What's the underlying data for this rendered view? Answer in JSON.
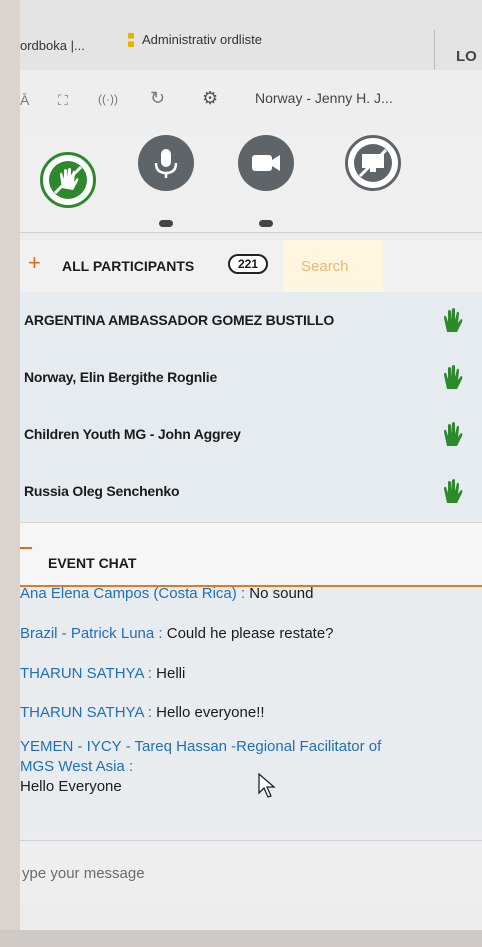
{
  "browser": {
    "tab_left": "ordboka |...",
    "tab_center": "Administrativ ordliste",
    "tab_right": "LO"
  },
  "toolbar": {
    "text_icon": "Ā",
    "fullscreen_icon": "⛶",
    "broadcast_icon": "((·))",
    "refresh_icon": "↻",
    "settings_icon": "⚙",
    "title": "Norway - Jenny H. J..."
  },
  "participants": {
    "header": "ALL PARTICIPANTS",
    "count": "221",
    "search_placeholder": "Search",
    "items": [
      {
        "name": "ARGENTINA AMBASSADOR GOMEZ BUSTILLO"
      },
      {
        "name": "Norway, Elin Bergithe Rognlie"
      },
      {
        "name": "Children Youth MG - John Aggrey"
      },
      {
        "name": "Russia Oleg Senchenko"
      }
    ],
    "hand_color": "#2c8a2c"
  },
  "chat": {
    "header": "EVENT CHAT",
    "messages": [
      {
        "sender": "Ana Elena Campos (Costa Rica) :",
        "text": "No sound"
      },
      {
        "sender": "Brazil - Patrick Luna :",
        "text": "Could he please restate?"
      },
      {
        "sender": "THARUN SATHYA :",
        "text": "Helli"
      },
      {
        "sender": "THARUN SATHYA :",
        "text": "Hello everyone!!"
      }
    ],
    "multi": {
      "sender_line1": "YEMEN - IYCY - Tareq Hassan -Regional Facilitator of",
      "sender_line2": "MGS West Asia :",
      "text": "Hello Everyone"
    },
    "composer_placeholder": "ype your message"
  },
  "colors": {
    "accent_orange": "#e57822",
    "sender_blue": "#1f6fb8",
    "control_gray": "#5f6468"
  }
}
